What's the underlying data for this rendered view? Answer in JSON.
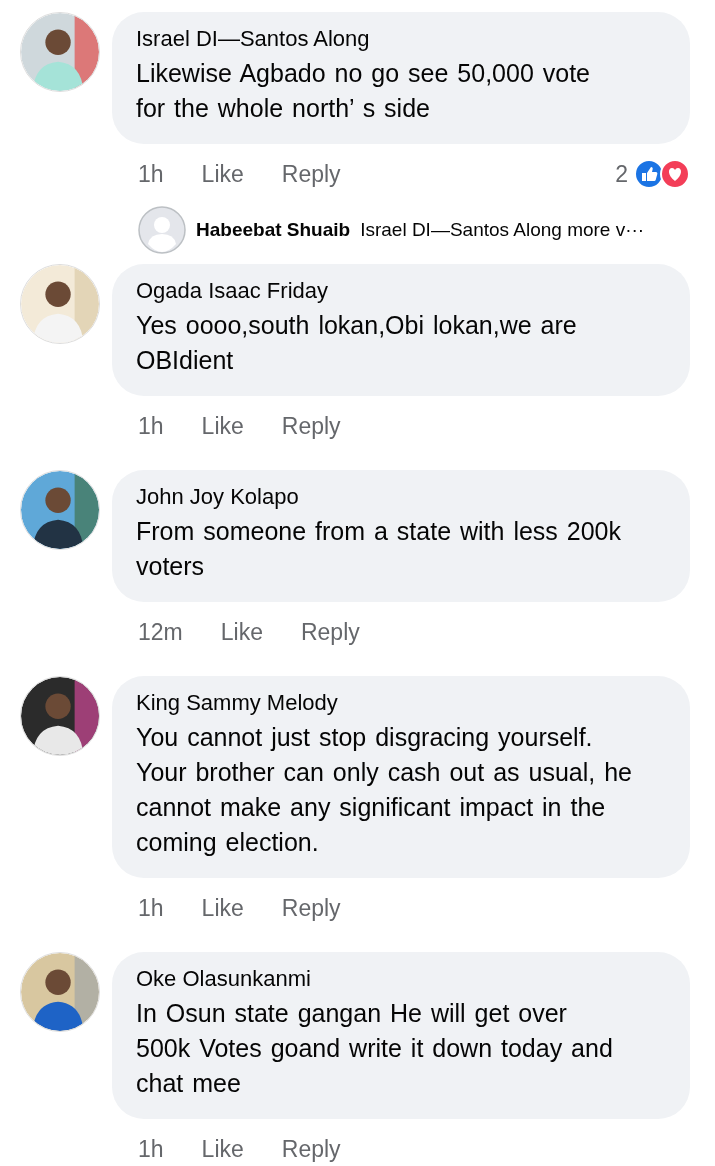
{
  "comments": [
    {
      "author": "Israel DI—Santos Along",
      "lines": [
        "Likewise Agbado no go see  50,000 vote",
        "for the whole north’ s side"
      ],
      "time": "1h",
      "like": "Like",
      "reply": "Reply",
      "reactions": {
        "count": "2"
      },
      "reply_preview": {
        "author": "Habeebat Shuaib",
        "text": "Israel DI—Santos Along more v···"
      }
    },
    {
      "author": "Ogada Isaac Friday",
      "lines": [
        "Yes oooo,south lokan,Obi lokan,we are",
        "OBIdient"
      ],
      "time": "1h",
      "like": "Like",
      "reply": "Reply"
    },
    {
      "author": "John Joy Kolapo",
      "lines": [
        "From someone from a state with less 200k",
        "voters"
      ],
      "time": "12m",
      "like": "Like",
      "reply": "Reply"
    },
    {
      "author": "King Sammy Melody",
      "lines": [
        "You cannot just stop disgracing yourself.",
        "Your brother can only cash out as usual, he",
        "cannot make any significant impact in the",
        "coming election."
      ],
      "time": "1h",
      "like": "Like",
      "reply": "Reply"
    },
    {
      "author": "Oke Olasunkanmi",
      "lines": [
        "In Osun state gangan He will get over",
        "500k Votes goand write it down today and",
        "chat mee"
      ],
      "time": "1h",
      "like": "Like",
      "reply": "Reply"
    }
  ]
}
